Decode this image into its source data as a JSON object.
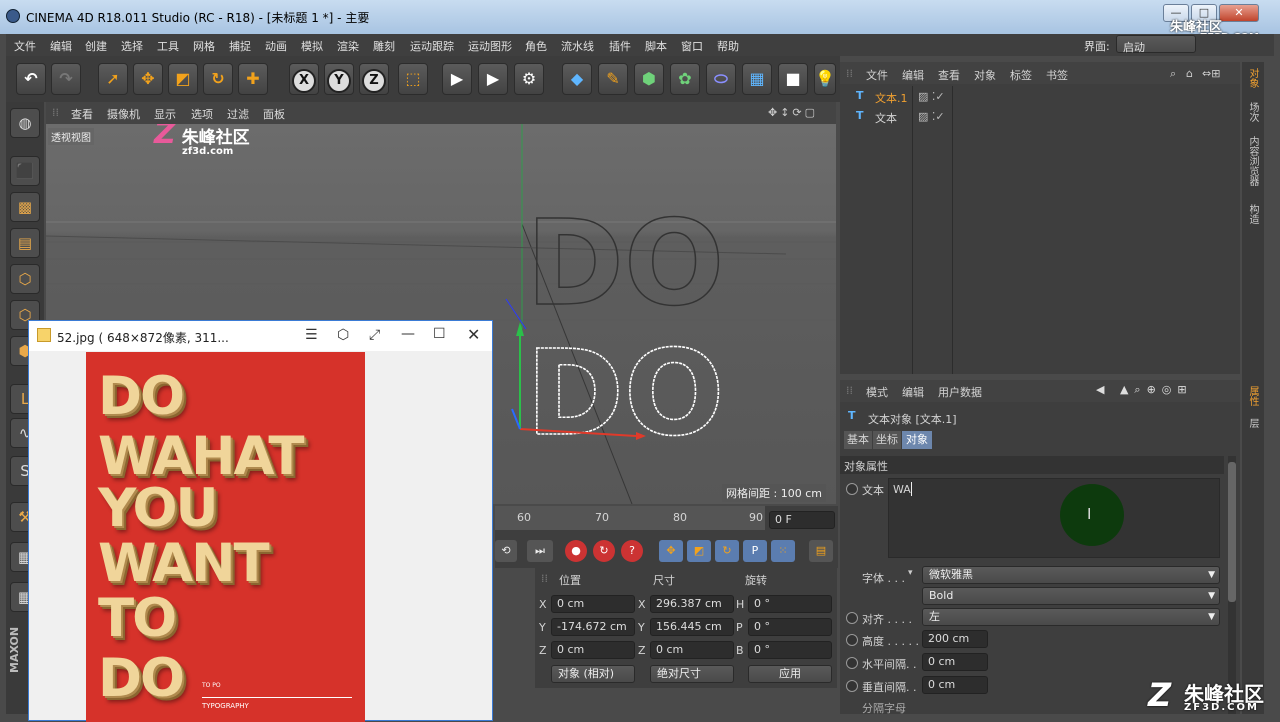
{
  "window": {
    "title": "CINEMA 4D R18.011 Studio (RC - R18) - [未标题 1 *] - 主要",
    "controls": [
      "—",
      "□",
      "✕"
    ]
  },
  "menubar": {
    "items": [
      "文件",
      "编辑",
      "创建",
      "选择",
      "工具",
      "网格",
      "捕捉",
      "动画",
      "模拟",
      "渲染",
      "雕刻",
      "运动跟踪",
      "运动图形",
      "角色",
      "流水线",
      "插件",
      "脚本",
      "窗口",
      "帮助"
    ],
    "layout_label": "界面:",
    "layout_value": "启动"
  },
  "watermark": {
    "brand": "朱峰社区",
    "url_small": "zf3d.com",
    "url_big": "ZF3D.COM"
  },
  "viewport": {
    "menu": [
      "查看",
      "摄像机",
      "显示",
      "选项",
      "过滤",
      "面板"
    ],
    "view_label": "透视视图",
    "grid_info": "网格间距 : 100 cm",
    "scene_text": "DO"
  },
  "object_manager": {
    "menu": [
      "文件",
      "编辑",
      "查看",
      "对象",
      "标签",
      "书签"
    ],
    "objects": [
      {
        "name": "文本.1",
        "selected": true
      },
      {
        "name": "文本",
        "selected": false
      }
    ]
  },
  "attribute_manager": {
    "menu": [
      "模式",
      "编辑",
      "用户数据"
    ],
    "object_title": "文本对象 [文本.1]",
    "tabs": [
      "基本",
      "坐标",
      "对象"
    ],
    "active_tab": "对象",
    "section": "对象属性",
    "text_label": "文本",
    "text_value": "WA",
    "font_label": "字体 . . .",
    "font_value": "微软雅黑",
    "weight_value": "Bold",
    "align_label": "对齐 . . . .",
    "align_value": "左",
    "height_label": "高度 . . . . .",
    "height_value": "200 cm",
    "hspacing_label": "水平间隔. .",
    "hspacing_value": "0 cm",
    "vspacing_label": "垂直间隔. .",
    "vspacing_value": "0 cm",
    "partial_label": "分隔字母"
  },
  "right_tabs": [
    "对象",
    "场次",
    "内容浏览器",
    "构造",
    "属性",
    "层"
  ],
  "timeline": {
    "ticks": [
      "60",
      "70",
      "80",
      "90"
    ],
    "frame": "0 F"
  },
  "coordinates": {
    "headers": [
      "位置",
      "尺寸",
      "旋转"
    ],
    "rows": [
      {
        "axis": "X",
        "pos": "0 cm",
        "size_axis": "X",
        "size": "296.387 cm",
        "rot_axis": "H",
        "rot": "0 °"
      },
      {
        "axis": "Y",
        "pos": "-174.672 cm",
        "size_axis": "Y",
        "size": "156.445 cm",
        "rot_axis": "P",
        "rot": "0 °"
      },
      {
        "axis": "Z",
        "pos": "0 cm",
        "size_axis": "Z",
        "size": "0 cm",
        "rot_axis": "B",
        "rot": "0 °"
      }
    ],
    "mode": "对象 (相对)",
    "size_mode": "绝对尺寸",
    "apply": "应用"
  },
  "image_viewer": {
    "title": "52.jpg ( 648×872像素, 311...",
    "poster_lines": [
      "DO",
      "WAHAT",
      "YOU",
      "WANT",
      "TO",
      "DO"
    ],
    "poster_small": [
      "TO  PO",
      "TYPOGRAPHY"
    ]
  },
  "colors": {
    "poster_red": "#d6322a",
    "gold": "#f0d59a",
    "accent_orange": "#f2a21c",
    "selected_object": "#f0a030"
  }
}
